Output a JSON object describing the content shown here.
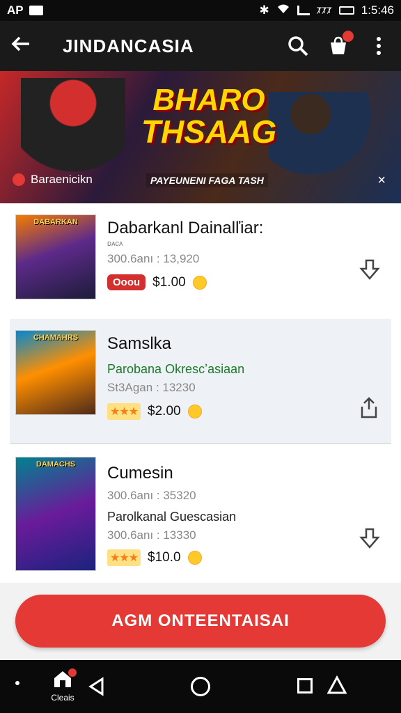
{
  "status_bar": {
    "left_text": "AP",
    "time": "1:5:46",
    "battery_label": "ȾȾȾ"
  },
  "app_bar": {
    "title": "JINDANCASIA"
  },
  "banner": {
    "title_line1": "BHARO",
    "title_line2": "THSAAG",
    "subtitle": "PAYEUNENI FAGA TASH",
    "pill_label": "Baraenicikn",
    "close_glyph": "×"
  },
  "games": [
    {
      "thumb_caption": "DABARKAN",
      "name": "Dabarkanl Dainalľiar:",
      "meta_small": "ᴅᴀᴄᴀ",
      "meta": "300.6anı : 13,920",
      "tag": "Ooou",
      "price": "$1.00",
      "action_icon": "download-icon"
    },
    {
      "thumb_caption": "CHAMAHRS",
      "name": "Samslka",
      "desc": "Parobana Okrescʼasiaan",
      "meta": "St3Agan : 13230",
      "stars": "★★★",
      "price": "$2.00",
      "action_icon": "share-icon"
    },
    {
      "thumb_caption": "DAMACHS",
      "name": "Cumesin",
      "meta_small": "300.6anı : 35320",
      "desc": "Parolkanal Guescasian",
      "meta": "300.6anı : 13330",
      "stars": "★★★",
      "price": "$10.0",
      "action_icon": "download-icon"
    }
  ],
  "cta": {
    "label": "AGM  ONTEENTAISAI"
  },
  "nav_bar": {
    "home_label": "Cleais"
  },
  "colors": {
    "accent": "#e53935",
    "app_bar": "#1a1a1a",
    "green_text": "#1b7a2a"
  }
}
